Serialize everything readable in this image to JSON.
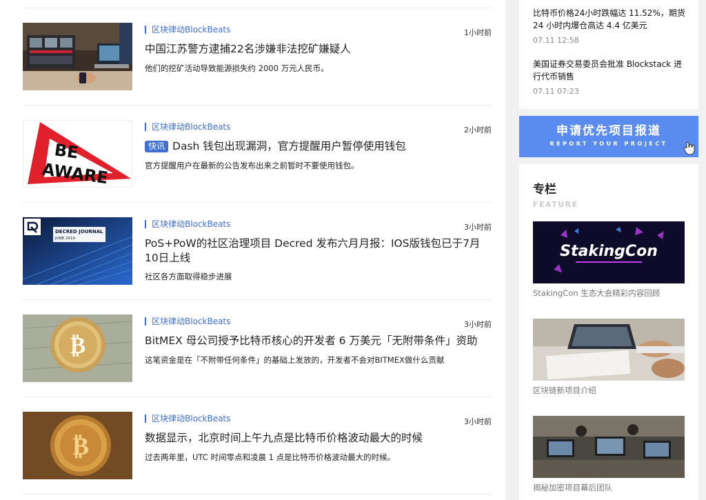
{
  "articles": [
    {
      "source": "区块律动BlockBeats",
      "time": "1小时前",
      "badge": "",
      "title": "中国江苏警方逮捕22名涉嫌非法挖矿嫌疑人",
      "summary": "他们的挖矿活动导致能源损失约 2000 万元人民币。"
    },
    {
      "source": "区块律动BlockBeats",
      "time": "2小时前",
      "badge": "快讯",
      "title": "Dash 钱包出现漏洞，官方提醒用户暂停使用钱包",
      "summary": "官方提醒用户在最新的公告发布出来之前暂时不要使用钱包。"
    },
    {
      "source": "区块律动BlockBeats",
      "time": "3小时前",
      "badge": "",
      "title": "PoS+PoW的社区治理项目 Decred 发布六月月报：IOS版钱包已于7月10日上线",
      "summary": "社区各方面取得稳步进展"
    },
    {
      "source": "区块律动BlockBeats",
      "time": "3小时前",
      "badge": "",
      "title": "BitMEX 母公司授予比特币核心的开发者 6 万美元「无附带条件」资助",
      "summary": "这笔资金是在「不附带任何条件」的基础上发放的，开发者不会对BITMEX做什么贡献"
    },
    {
      "source": "区块律动BlockBeats",
      "time": "3小时前",
      "badge": "",
      "title": "数据显示，北京时间上午九点是比特币价格波动最大的时候",
      "summary": "过去两年里，UTC 时间零点和凌晨 1 点是比特币价格波动最大的时候。"
    }
  ],
  "thumbs": {
    "beware_line1": "BE",
    "beware_line2": "AWARE",
    "decred_journal": "DECRED JOURNAL",
    "decred_date": "JUNE 2019"
  },
  "sidebar_news": [
    {
      "title": "比特币价格24小时跌幅达 11.52%，期货 24 小时内爆仓高达 4.4 亿美元",
      "date": "07.11 12:58"
    },
    {
      "title": "美国证券交易委员会批准 Blockstack 进行代币销售",
      "date": "07.11 07:23"
    }
  ],
  "banner": {
    "title_cn": "申请优先项目报道",
    "title_en": "REPORT YOUR PROJECT"
  },
  "column": {
    "title": "专栏",
    "subtitle": "FEATURE",
    "stakingcon_logo": "StakingCon",
    "items": [
      {
        "caption": "StakingCon 生态大会精彩内容回顾"
      },
      {
        "caption": "区块链新项目介绍"
      },
      {
        "caption": "揭秘加密项目幕后团队"
      }
    ]
  },
  "colors": {
    "accent": "#3f6fd0",
    "banner": "#5a8cf0"
  }
}
